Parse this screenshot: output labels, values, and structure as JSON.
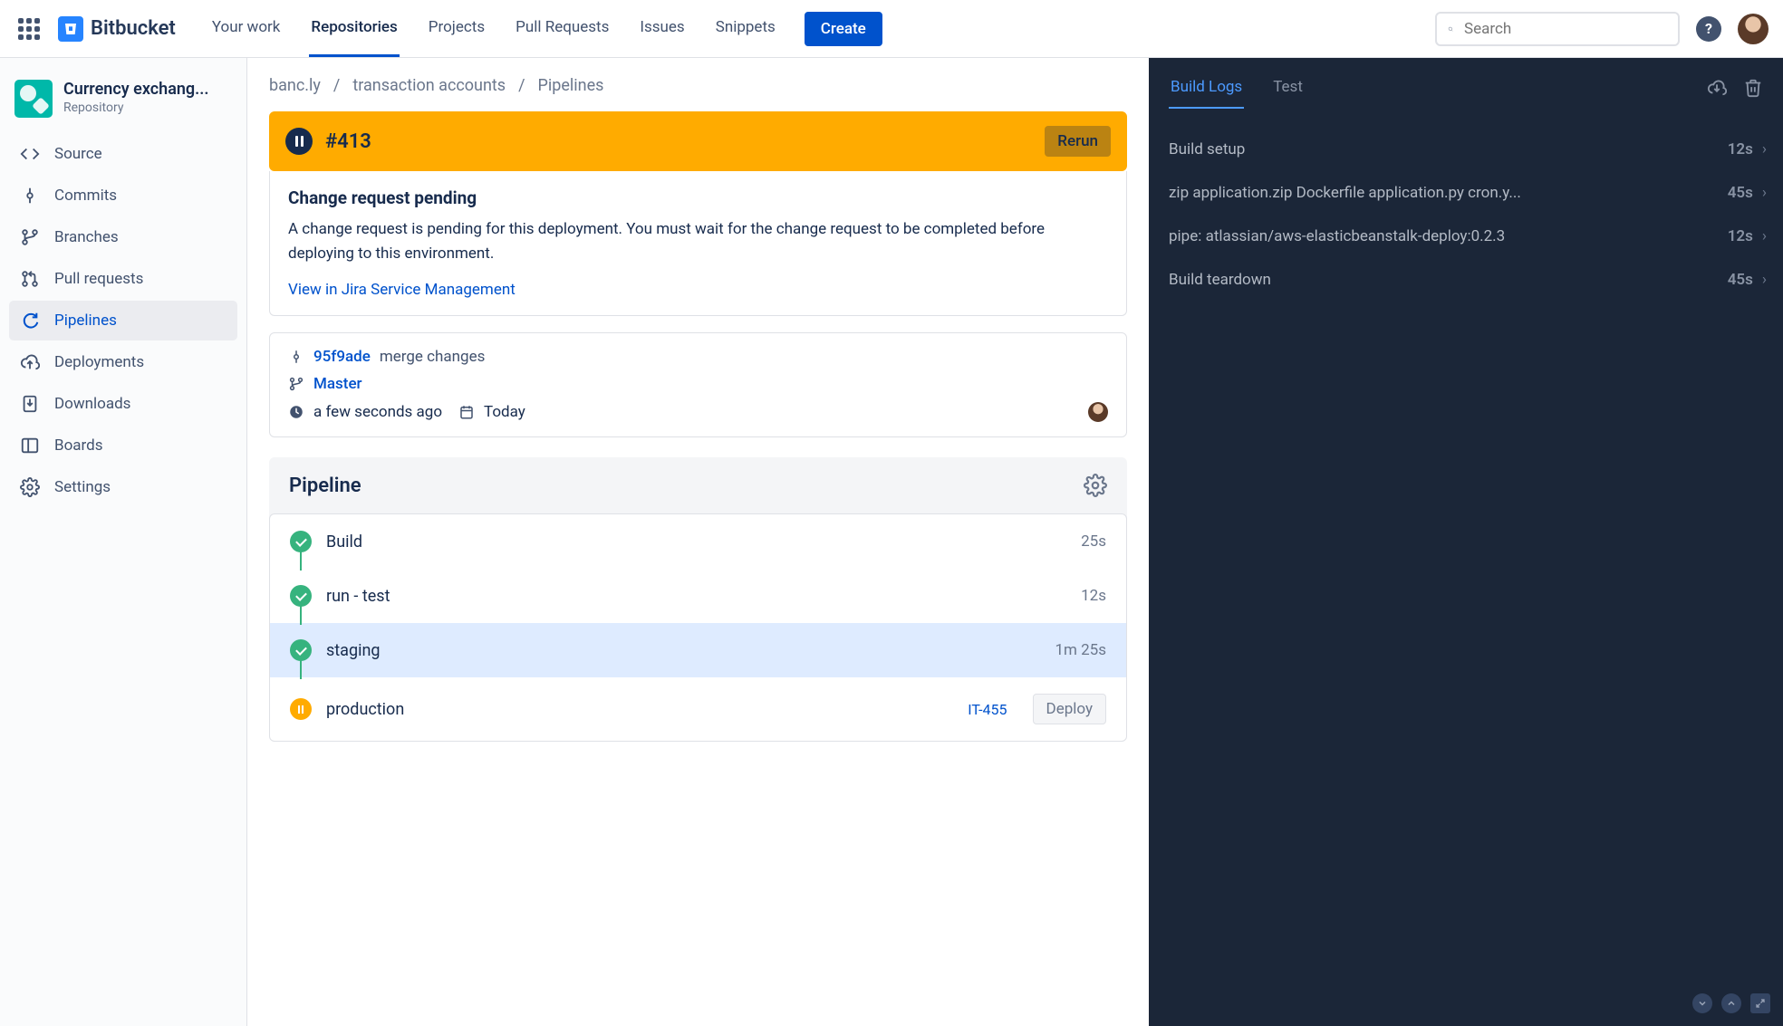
{
  "header": {
    "product": "Bitbucket",
    "nav": {
      "your_work": "Your work",
      "repositories": "Repositories",
      "projects": "Projects",
      "pull_requests": "Pull Requests",
      "issues": "Issues",
      "snippets": "Snippets"
    },
    "create": "Create",
    "search_placeholder": "Search",
    "help": "?"
  },
  "sidebar": {
    "repo_name": "Currency exchang...",
    "repo_sub": "Repository",
    "items": {
      "source": "Source",
      "commits": "Commits",
      "branches": "Branches",
      "pull_requests": "Pull requests",
      "pipelines": "Pipelines",
      "deployments": "Deployments",
      "downloads": "Downloads",
      "boards": "Boards",
      "settings": "Settings"
    }
  },
  "breadcrumbs": {
    "project": "banc.ly",
    "repo": "transaction accounts",
    "page": "Pipelines"
  },
  "run": {
    "number": "#413",
    "rerun": "Rerun"
  },
  "change_request": {
    "title": "Change request pending",
    "body": "A change request is pending for this deployment. You must wait for the change request to be completed before deploying to this environment.",
    "link": "View in Jira Service Management"
  },
  "commit": {
    "hash": "95f9ade",
    "message": "merge changes",
    "branch": "Master",
    "relative_time": "a few seconds ago",
    "date": "Today"
  },
  "pipeline": {
    "heading": "Pipeline",
    "stages": [
      {
        "name": "Build",
        "duration": "25s",
        "status": "ok"
      },
      {
        "name": "run - test",
        "duration": "12s",
        "status": "ok"
      },
      {
        "name": "staging",
        "duration": "1m 25s",
        "status": "ok",
        "active": true
      },
      {
        "name": "production",
        "status": "pause",
        "jira": "IT-455",
        "deploy": "Deploy"
      }
    ]
  },
  "logs": {
    "tabs": {
      "build_logs": "Build Logs",
      "test": "Test"
    },
    "rows": [
      {
        "text": "Build setup",
        "time": "12s"
      },
      {
        "text": "zip application.zip Dockerfile application.py cron.y...",
        "time": "45s"
      },
      {
        "text": "pipe: atlassian/aws-elasticbeanstalk-deploy:0.2.3",
        "time": "12s"
      },
      {
        "text": "Build teardown",
        "time": "45s"
      }
    ]
  }
}
